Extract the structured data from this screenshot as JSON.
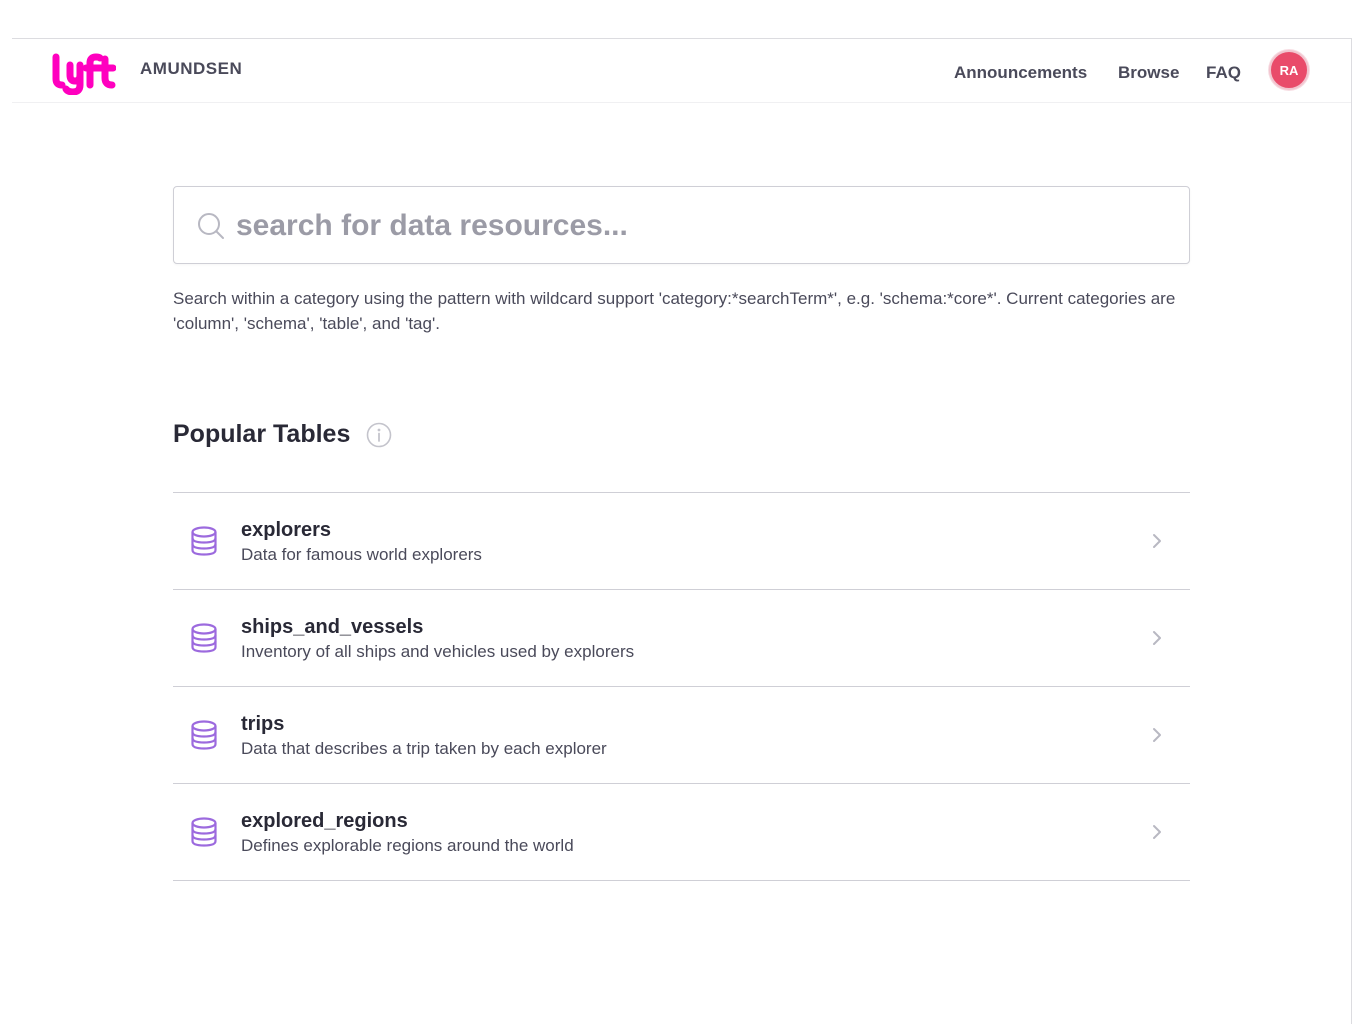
{
  "header": {
    "brand": "AMUNDSEN",
    "logo_icon": "lyft-logo",
    "nav": {
      "announcements": "Announcements",
      "browse": "Browse",
      "faq": "FAQ"
    },
    "avatar_initials": "RA"
  },
  "search": {
    "placeholder": "search for data resources...",
    "value": "",
    "icon": "search-icon",
    "help_text": "Search within a category using the pattern with wildcard support 'category:*searchTerm*', e.g. 'schema:*core*'. Current categories are 'column', 'schema', 'table', and 'tag'."
  },
  "popular": {
    "title": "Popular Tables",
    "info_icon": "info-icon",
    "rows": [
      {
        "name": "explorers",
        "description": "Data for famous world explorers"
      },
      {
        "name": "ships_and_vessels",
        "description": "Inventory of all ships and vehicles used by explorers"
      },
      {
        "name": "trips",
        "description": "Data that describes a trip taken by each explorer"
      },
      {
        "name": "explored_regions",
        "description": "Defines explorable regions around the world"
      }
    ]
  },
  "colors": {
    "brand_pink": "#ff00bf",
    "avatar_bg": "#e94b6a",
    "db_icon": "#9c6ade",
    "text_primary": "#292936",
    "text_secondary": "#4a4a5a"
  }
}
